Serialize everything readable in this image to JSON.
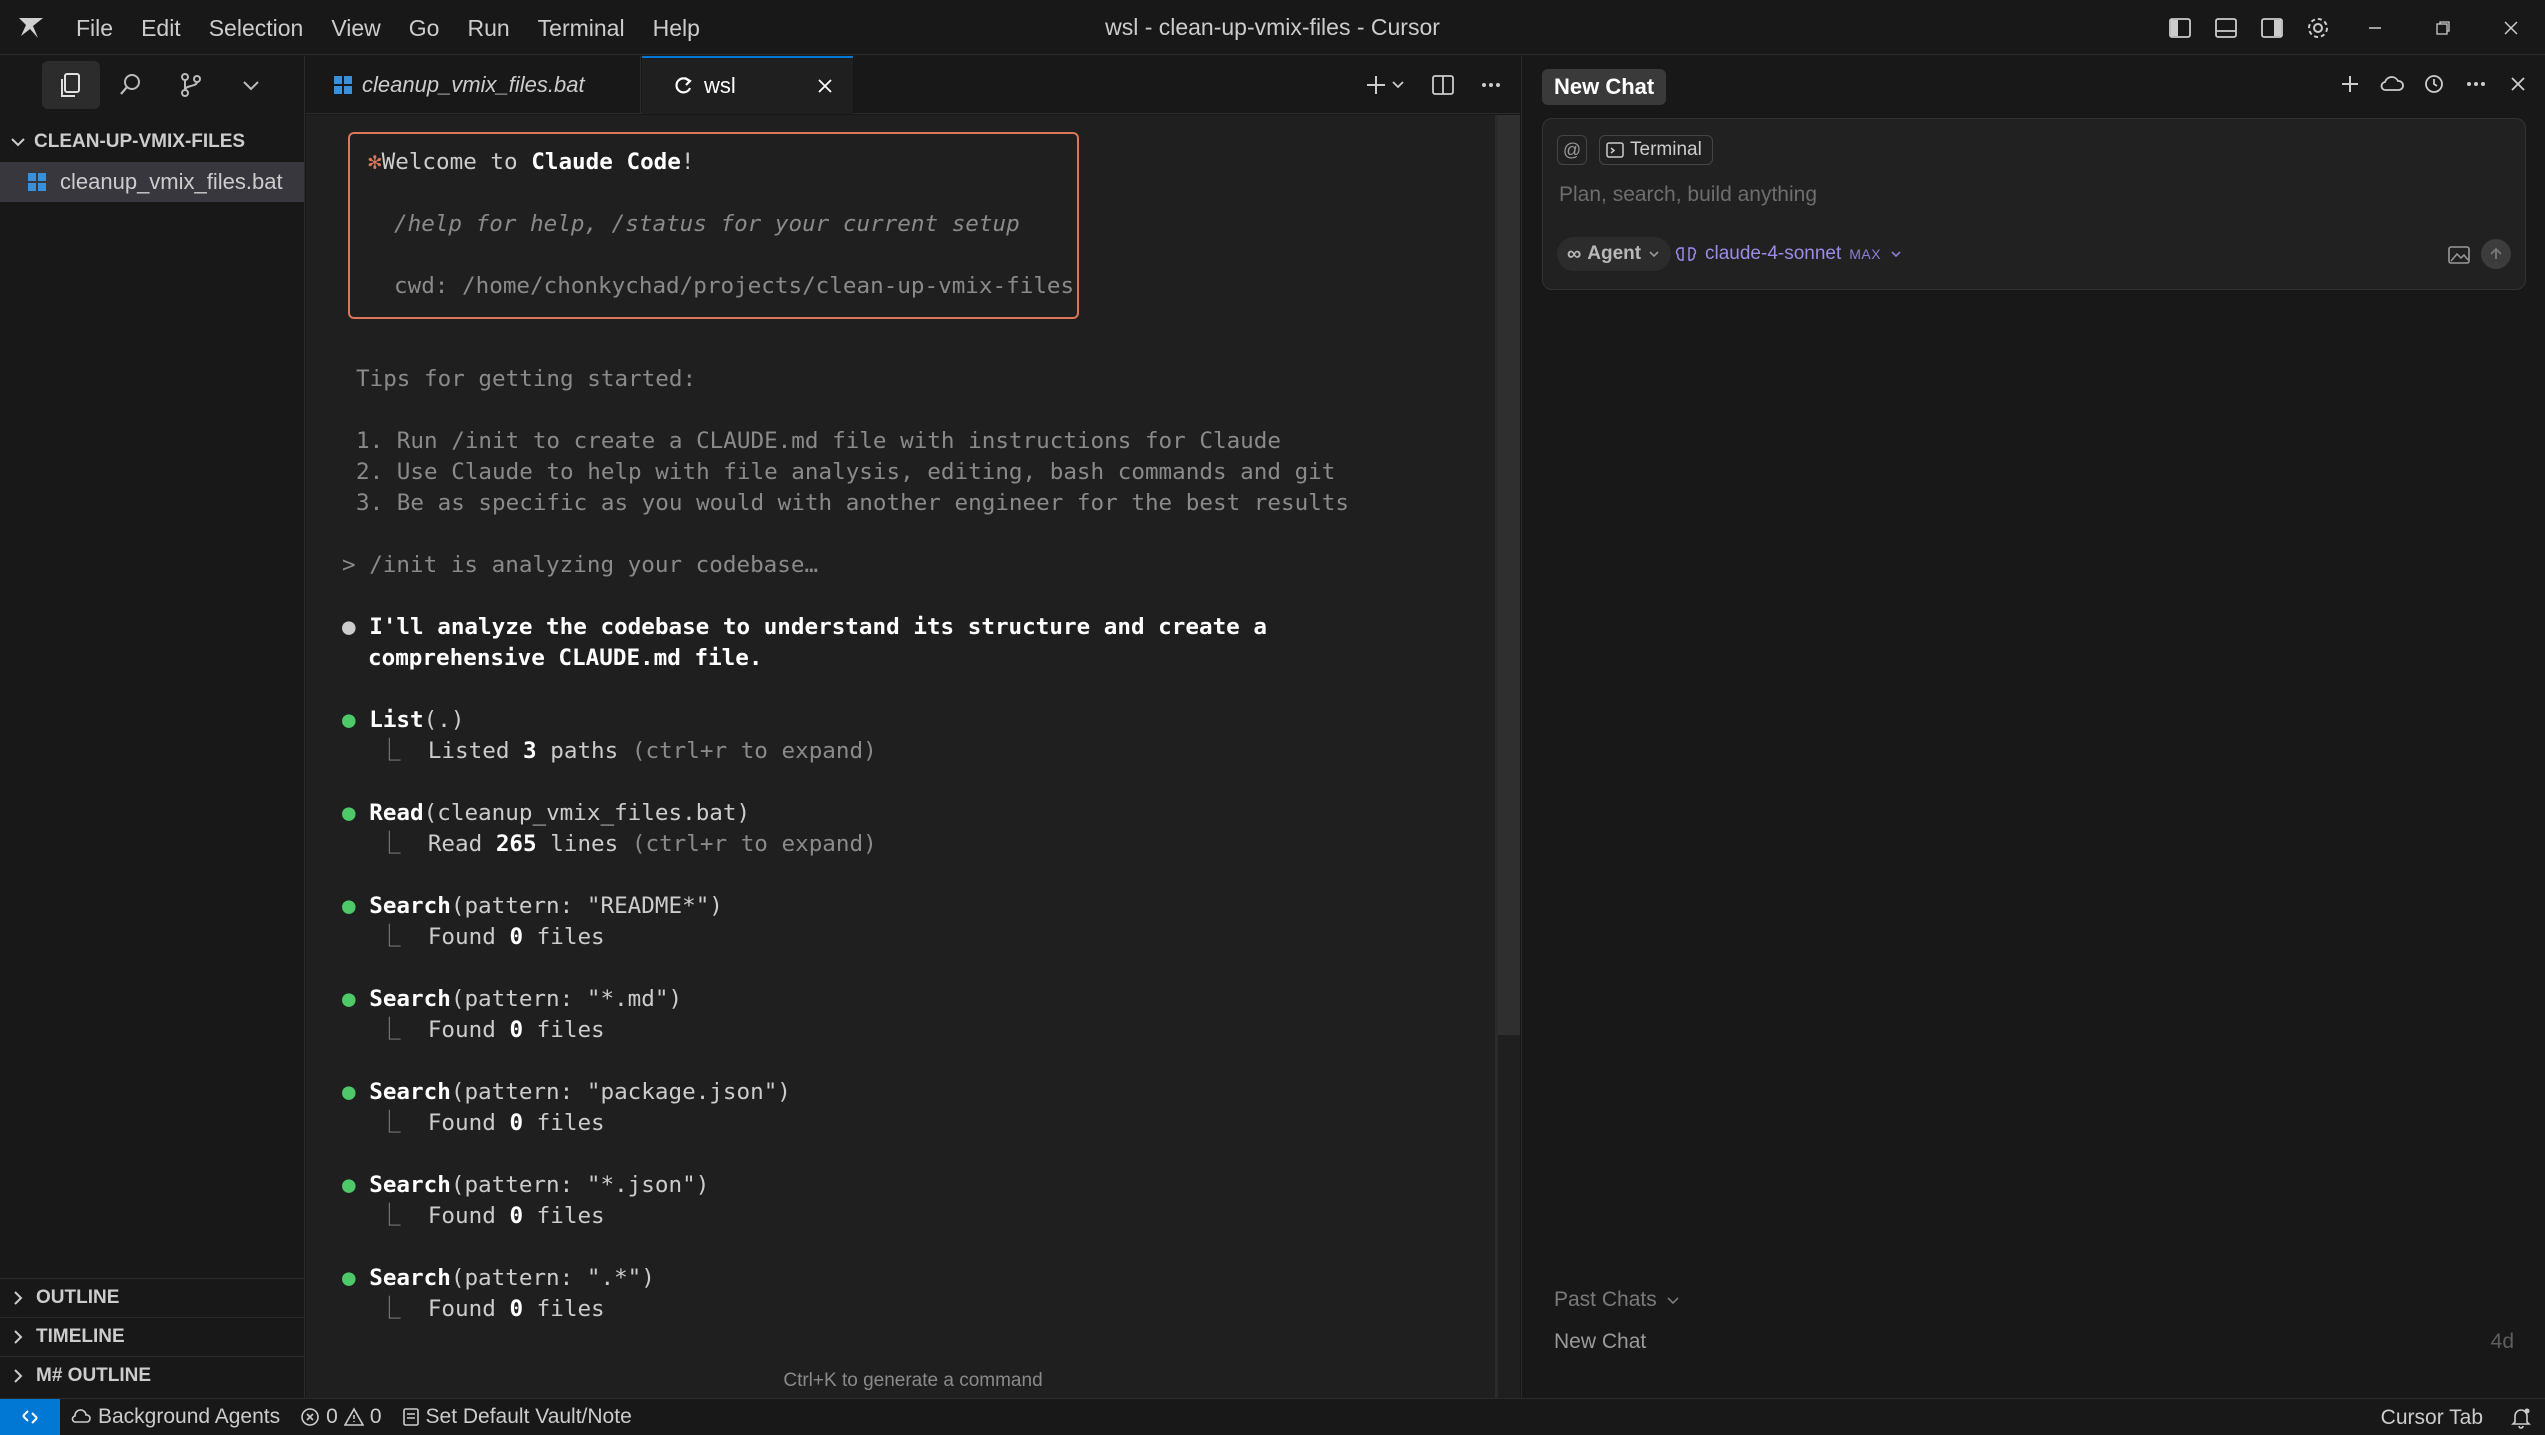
{
  "window": {
    "title": "wsl - clean-up-vmix-files - Cursor"
  },
  "menu": [
    "File",
    "Edit",
    "Selection",
    "View",
    "Go",
    "Run",
    "Terminal",
    "Help"
  ],
  "sidebar": {
    "folder_name": "CLEAN-UP-VMIX-FILES",
    "files": [
      {
        "name": "cleanup_vmix_files.bat"
      }
    ],
    "sections": [
      "OUTLINE",
      "TIMELINE",
      "M# OUTLINE"
    ]
  },
  "editor": {
    "tabs": [
      {
        "label": "cleanup_vmix_files.bat",
        "icon": "windows-file-icon"
      },
      {
        "label": "wsl",
        "icon": "terminal-sync-icon",
        "active": true
      }
    ]
  },
  "terminal": {
    "welcome_prefix": "Welcome to ",
    "welcome_bold": "Claude Code",
    "welcome_suffix": "!",
    "help_line": "/help for help, /status for your current setup",
    "cwd_line": "cwd: /home/chonkychad/projects/clean-up-vmix-files",
    "tips_title": "Tips for getting started:",
    "tips": [
      "1. Run /init to create a CLAUDE.md file with instructions for Claude",
      "2. Use Claude to help with file analysis, editing, bash commands and git",
      "3. Be as specific as you would with another engineer for the best results"
    ],
    "prompt_line": "> /init is analyzing your codebase…",
    "message_lines": [
      "I'll analyze the codebase to understand its structure and create a",
      "comprehensive CLAUDE.md file."
    ],
    "tool_calls": [
      {
        "name": "List",
        "args": "(.)",
        "result_prefix": "Listed ",
        "result_count": "3",
        "result_suffix": " paths",
        "hint": " (ctrl+r to expand)"
      },
      {
        "name": "Read",
        "args": "(cleanup_vmix_files.bat)",
        "result_prefix": "Read ",
        "result_count": "265",
        "result_suffix": " lines",
        "hint": " (ctrl+r to expand)"
      },
      {
        "name": "Search",
        "args": "(pattern: \"README*\")",
        "result_prefix": "Found ",
        "result_count": "0",
        "result_suffix": " files",
        "hint": ""
      },
      {
        "name": "Search",
        "args": "(pattern: \"*.md\")",
        "result_prefix": "Found ",
        "result_count": "0",
        "result_suffix": " files",
        "hint": ""
      },
      {
        "name": "Search",
        "args": "(pattern: \"package.json\")",
        "result_prefix": "Found ",
        "result_count": "0",
        "result_suffix": " files",
        "hint": ""
      },
      {
        "name": "Search",
        "args": "(pattern: \"*.json\")",
        "result_prefix": "Found ",
        "result_count": "0",
        "result_suffix": " files",
        "hint": ""
      },
      {
        "name": "Search",
        "args": "(pattern: \".*\")",
        "result_prefix": "Found ",
        "result_count": "0",
        "result_suffix": " files",
        "hint": ""
      }
    ],
    "hint": "Ctrl+K to generate a command"
  },
  "chat": {
    "tab_label": "New Chat",
    "context_pill": "Terminal",
    "input_placeholder": "Plan, search, build anything",
    "mode": "Agent",
    "model": "claude-4-sonnet",
    "model_badge": "MAX",
    "past_chats_label": "Past Chats",
    "past_chats": [
      {
        "title": "New Chat",
        "age": "4d"
      }
    ]
  },
  "statusbar": {
    "background_agents": "Background Agents",
    "errors": "0",
    "warnings": "0",
    "vault": "Set Default Vault/Note",
    "cursor_tab": "Cursor Tab"
  },
  "colors": {
    "accent": "#0078d4",
    "claude_orange": "#d97757",
    "model_purple": "#9d8be8",
    "bullet_green": "#4ec969"
  }
}
